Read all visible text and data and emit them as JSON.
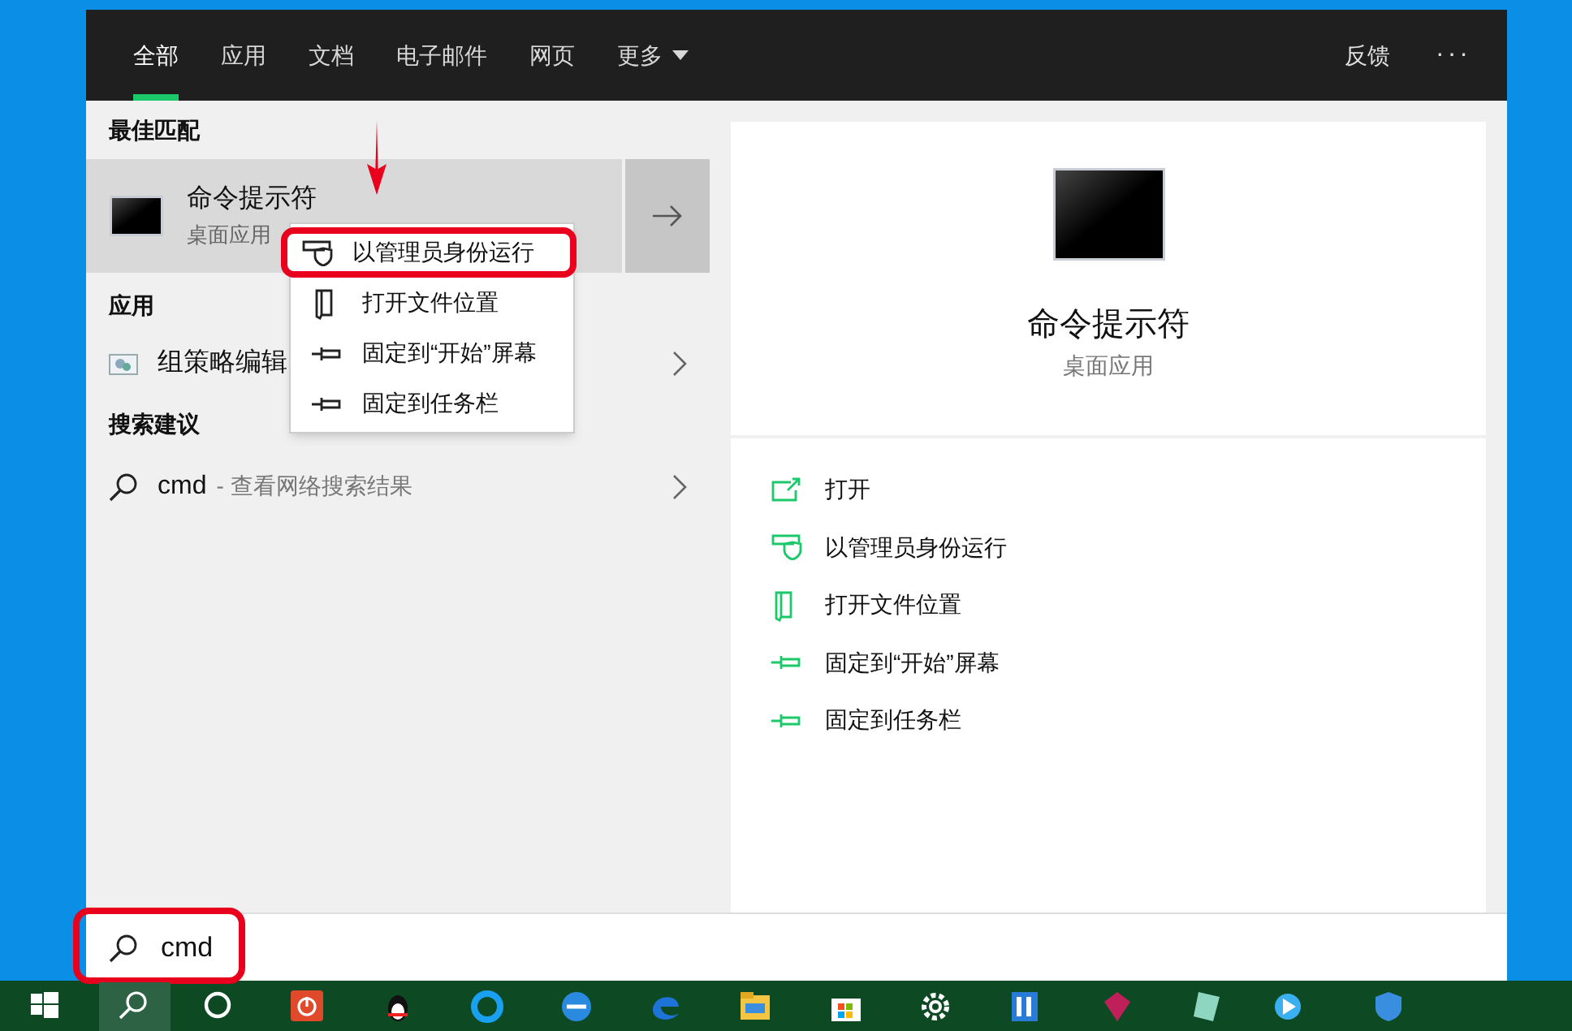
{
  "tabs": [
    {
      "label": "全部",
      "selected": true
    },
    {
      "label": "应用",
      "selected": false
    },
    {
      "label": "文档",
      "selected": false
    },
    {
      "label": "电子邮件",
      "selected": false
    },
    {
      "label": "网页",
      "selected": false
    },
    {
      "label": "更多",
      "selected": false,
      "dropdown": true
    }
  ],
  "header_actions": {
    "feedback": "反馈",
    "more": "···"
  },
  "best_match": {
    "heading": "最佳匹配",
    "title": "命令提示符",
    "subtitle": "桌面应用"
  },
  "apps": {
    "heading": "应用",
    "items": [
      {
        "title": "组策略编辑"
      }
    ]
  },
  "suggestions": {
    "heading": "搜索建议",
    "items": [
      {
        "query": "cmd",
        "hint": "- 查看网络搜索结果"
      }
    ]
  },
  "context_menu": [
    {
      "label": "以管理员身份运行",
      "kind": "shield",
      "highlighted": true
    },
    {
      "label": "打开文件位置",
      "kind": "folder",
      "highlighted": false
    },
    {
      "label": "固定到“开始”屏幕",
      "kind": "pin",
      "highlighted": false
    },
    {
      "label": "固定到任务栏",
      "kind": "pin",
      "highlighted": false
    }
  ],
  "preview": {
    "title": "命令提示符",
    "subtitle": "桌面应用"
  },
  "actions": [
    {
      "label": "打开",
      "kind": "open"
    },
    {
      "label": "以管理员身份运行",
      "kind": "shield"
    },
    {
      "label": "打开文件位置",
      "kind": "folder"
    },
    {
      "label": "固定到“开始”屏幕",
      "kind": "pin"
    },
    {
      "label": "固定到任务栏",
      "kind": "pin"
    }
  ],
  "search": {
    "value": "cmd"
  },
  "taskbar": {
    "search_selected": true
  }
}
